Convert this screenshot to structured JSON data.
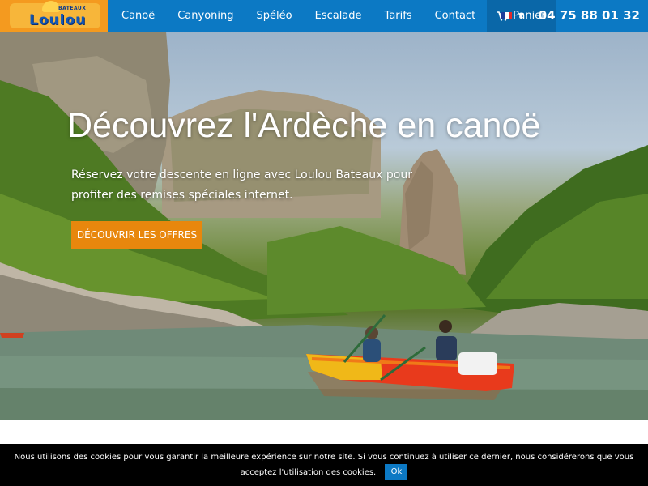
{
  "brand": {
    "logo_text": "Loulou",
    "logo_subtext": "BATEAUX"
  },
  "nav": {
    "items": [
      {
        "label": "Canoë"
      },
      {
        "label": "Canyoning"
      },
      {
        "label": "Spéléo"
      },
      {
        "label": "Escalade"
      },
      {
        "label": "Tarifs"
      },
      {
        "label": "Contact"
      }
    ],
    "cart_label": "Panier",
    "cart_icon": "cart-icon",
    "language_flag": "french-flag-icon",
    "phone": "04 75 88 01 32"
  },
  "hero": {
    "title": "Découvrez l'Ardèche en canoë",
    "subtitle": "Réservez votre descente en ligne avec Loulou Bateaux pour profiter des remises spéciales internet.",
    "cta_label": "DÉCOUVRIR LES OFFRES"
  },
  "cookie_banner": {
    "text": "Nous utilisons des cookies pour vous garantir la meilleure expérience sur notre site. Si vous continuez à utiliser ce dernier, nous considérerons que vous acceptez l'utilisation des cookies.",
    "ok_label": "Ok"
  },
  "colors": {
    "nav_blue": "#0c79c4",
    "cta_orange": "#e8870d",
    "logo_orange": "#f49a1f"
  }
}
